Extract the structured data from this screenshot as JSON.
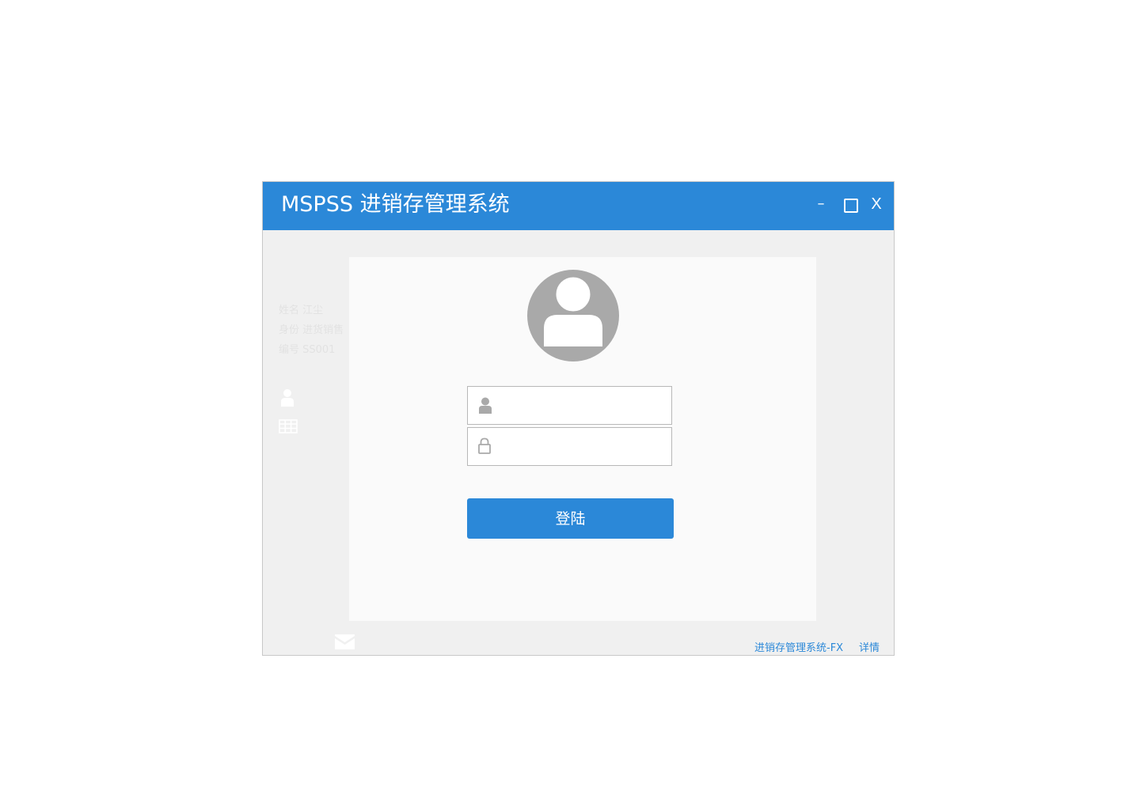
{
  "window": {
    "title": "MSPSS 进销存管理系统",
    "controls": {
      "minimize": "–",
      "close": "X"
    }
  },
  "sidebar": {
    "name_line": "姓名 江尘",
    "role_line": "身份 进货销售",
    "id_line": "编号 SS001",
    "icons": [
      "user-icon",
      "table-icon",
      "mail-icon"
    ]
  },
  "login": {
    "avatar_icon": "avatar-icon",
    "username": {
      "value": "",
      "placeholder": "",
      "icon": "user-icon"
    },
    "password": {
      "value": "",
      "placeholder": "",
      "icon": "lock-icon"
    },
    "submit_label": "登陆"
  },
  "footer": {
    "system_link": "进销存管理系统-FX",
    "detail_link": "详情"
  },
  "colors": {
    "accent": "#2b88d8",
    "window_bg": "#f0f0f0",
    "panel_bg": "#fafafa",
    "icon_gray": "#a9a9a9"
  }
}
